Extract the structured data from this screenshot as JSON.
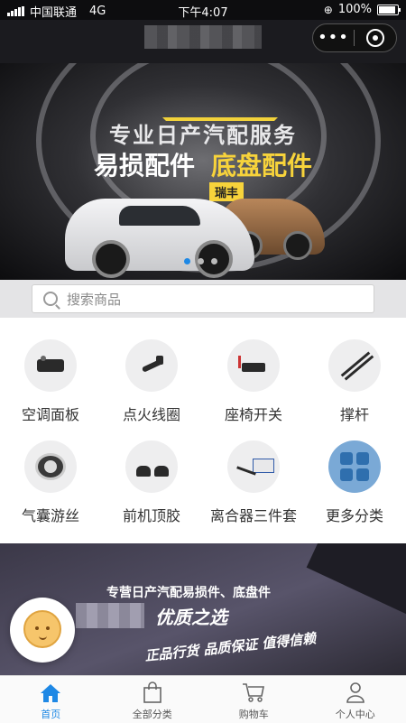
{
  "status": {
    "carrier": "中国联通",
    "network": "4G",
    "time": "下午4:07",
    "battery": "100%",
    "battery_level": 1.0
  },
  "banner": {
    "subtitle": "专业日产汽配服务",
    "headline_white": "易损配件",
    "headline_yellow": "底盘配件",
    "brand_tag": "瑞丰",
    "slide_count": 3,
    "active_slide": 1
  },
  "search": {
    "placeholder": "搜索商品"
  },
  "categories": [
    {
      "label": "空调面板"
    },
    {
      "label": "点火线圈"
    },
    {
      "label": "座椅开关"
    },
    {
      "label": "撑杆"
    },
    {
      "label": "气囊游丝"
    },
    {
      "label": "前机顶胶"
    },
    {
      "label": "离合器三件套"
    },
    {
      "label": "更多分类"
    }
  ],
  "promo": {
    "line1": "专营日产汽配易损件、底盘件",
    "line2": "优质之选",
    "line3": "正品行货  品质保证  值得信赖"
  },
  "tabbar": [
    {
      "label": "首页",
      "icon": "home-icon",
      "active": true
    },
    {
      "label": "全部分类",
      "icon": "bag-icon",
      "active": false
    },
    {
      "label": "购物车",
      "icon": "cart-icon",
      "active": false
    },
    {
      "label": "个人中心",
      "icon": "user-icon",
      "active": false
    }
  ],
  "colors": {
    "accent": "#1e88e5",
    "banner_yellow": "#f7d33b"
  }
}
